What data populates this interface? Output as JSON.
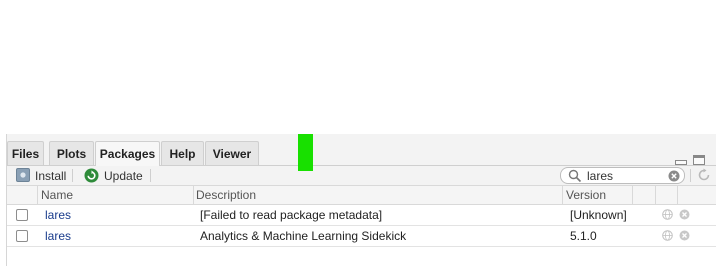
{
  "tabs": [
    {
      "label": "Files",
      "active": false
    },
    {
      "label": "Plots",
      "active": false
    },
    {
      "label": "Packages",
      "active": true
    },
    {
      "label": "Help",
      "active": false
    },
    {
      "label": "Viewer",
      "active": false
    }
  ],
  "toolbar": {
    "install_label": "Install",
    "update_label": "Update"
  },
  "search": {
    "value": "lares"
  },
  "table": {
    "headers": {
      "name": "Name",
      "description": "Description",
      "version": "Version"
    },
    "rows": [
      {
        "name": "lares",
        "description": "[Failed to read package metadata]",
        "version": "[Unknown]",
        "checked": false
      },
      {
        "name": "lares",
        "description": "Analytics & Machine Learning Sidekick",
        "version": "5.1.0",
        "checked": false
      }
    ]
  },
  "colors": {
    "accent_green": "#18e000",
    "link_blue": "#1a3c8c",
    "update_icon_green": "#2e8b3a"
  }
}
